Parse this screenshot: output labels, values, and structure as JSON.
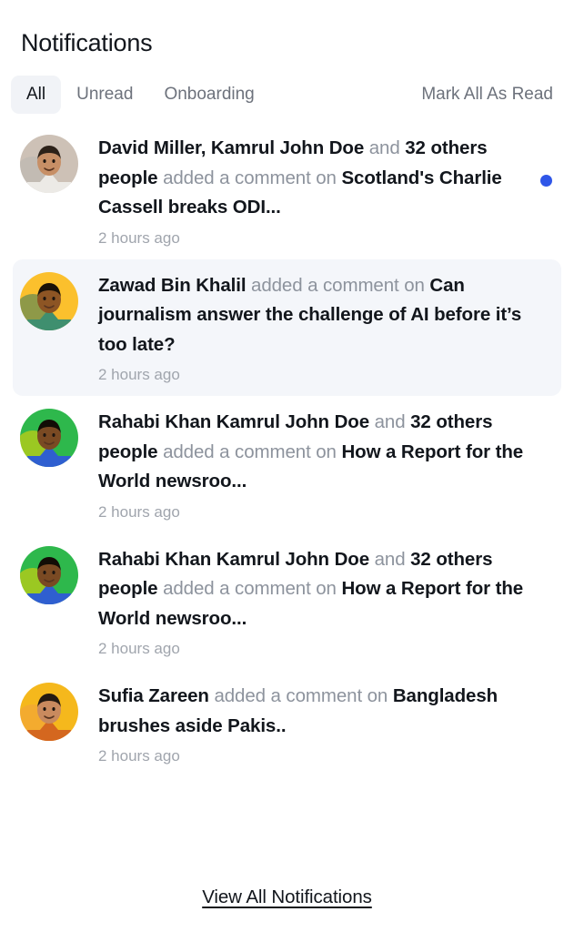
{
  "header": {
    "title": "Notifications"
  },
  "tabs": [
    {
      "id": "all",
      "label": "All",
      "active": true
    },
    {
      "id": "unread",
      "label": "Unread",
      "active": false
    },
    {
      "id": "onboarding",
      "label": "Onboarding",
      "active": false
    }
  ],
  "actions": {
    "mark_all_as_read": "Mark All As Read"
  },
  "colors": {
    "accent_unread_dot": "#2f56e8",
    "highlight_row_bg": "#f4f6fa",
    "active_tab_bg": "#f1f3f7",
    "primary_text": "#12161c",
    "muted_text": "#8d939d",
    "time_text": "#a0a5ad"
  },
  "notifications": [
    {
      "id": "n1",
      "actors": "David Miller, Kamrul John Doe",
      "connector": " and ",
      "others": "32 others people",
      "action": " added a comment on ",
      "subject": "Scotland's Charlie Cassell breaks ODI...",
      "time": "2 hours ago",
      "unread": true,
      "highlighted": false,
      "avatar": {
        "name": "avatar-david-miller",
        "bg": "#cdc1b6",
        "skin": "#c78f66",
        "hair": "#2c2118",
        "shirt": "#eceae6",
        "shirt_stripe": "#b9b6b0"
      }
    },
    {
      "id": "n2",
      "actors": "Zawad Bin Khalil",
      "connector": "",
      "others": "",
      "action": " added a comment on ",
      "subject": "Can journalism answer the challenge of AI before it’s too late?",
      "time": "2 hours ago",
      "unread": false,
      "highlighted": true,
      "avatar": {
        "name": "avatar-zawad-bin-khalil",
        "bg": "#fbc02d",
        "skin": "#8d5524",
        "hair": "#1a1208",
        "shirt": "#3f8f6f",
        "shirt_stripe": "#35795e"
      }
    },
    {
      "id": "n3",
      "actors": "Rahabi Khan Kamrul John Doe",
      "connector": " and ",
      "others": "32 others people",
      "action": " added a comment on ",
      "subject": "How a Report for the World newsroo...",
      "time": "2 hours ago",
      "unread": false,
      "highlighted": false,
      "avatar": {
        "name": "avatar-rahabi-khan",
        "bg": "#2eb84c",
        "skin": "#7a4a23",
        "hair": "#120d06",
        "shirt": "#2f5fd0",
        "shirt_stripe": "#f5d500"
      }
    },
    {
      "id": "n4",
      "actors": "Rahabi Khan Kamrul John Doe",
      "connector": " and ",
      "others": "32 others people",
      "action": " added a comment on ",
      "subject": "How a Report for the World newsroo...",
      "time": "2 hours ago",
      "unread": false,
      "highlighted": false,
      "avatar": {
        "name": "avatar-rahabi-khan",
        "bg": "#2eb84c",
        "skin": "#7a4a23",
        "hair": "#120d06",
        "shirt": "#2f5fd0",
        "shirt_stripe": "#f5d500"
      }
    },
    {
      "id": "n5",
      "actors": "Sufia Zareen",
      "connector": "",
      "others": "",
      "action": " added a comment on ",
      "subject": "Bangladesh brushes aside Pakis..",
      "time": "2 hours ago",
      "unread": false,
      "highlighted": false,
      "avatar": {
        "name": "avatar-sufia-zareen",
        "bg": "#f5b81c",
        "skin": "#c98a5e",
        "hair": "#241a12",
        "shirt": "#d4671f",
        "shirt_stripe": "#f0a040"
      }
    }
  ],
  "footer": {
    "view_all_label": "View All Notifications"
  }
}
